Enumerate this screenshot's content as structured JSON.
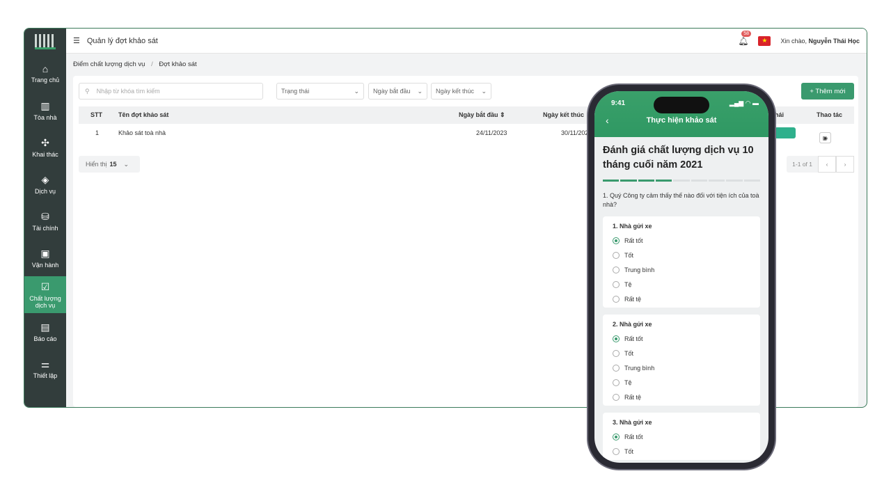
{
  "sidebar": {
    "items": [
      {
        "label": "Trang chủ",
        "icon": "home-icon",
        "glyph": "⌂"
      },
      {
        "label": "Tòa nhà",
        "icon": "building-icon",
        "glyph": "▥"
      },
      {
        "label": "Khai thác",
        "icon": "handshake-icon",
        "glyph": "✣"
      },
      {
        "label": "Dịch vụ",
        "icon": "layers-icon",
        "glyph": "◈"
      },
      {
        "label": "Tài chính",
        "icon": "coins-icon",
        "glyph": "⛁"
      },
      {
        "label": "Vận hành",
        "icon": "briefcase-icon",
        "glyph": "▣"
      },
      {
        "label": "Chất lượng dịch vụ",
        "icon": "calendar-check-icon",
        "glyph": "☑",
        "active": true
      },
      {
        "label": "Báo cáo",
        "icon": "report-icon",
        "glyph": "▤"
      },
      {
        "label": "Thiết lập",
        "icon": "sliders-icon",
        "glyph": "⚌"
      }
    ]
  },
  "header": {
    "title": "Quản lý đợt khảo sát",
    "notifications": "58",
    "greeting": "Xin chào,",
    "user": "Nguyễn Thái Học"
  },
  "breadcrumb": {
    "parent": "Điểm chất lượng dịch vụ",
    "sep": "/",
    "current": "Đợt khảo sát"
  },
  "filters": {
    "search_placeholder": "Nhập từ khóa tìm kiếm",
    "status": "Trạng thái",
    "start": "Ngày bắt đầu",
    "end": "Ngày kết thúc",
    "add": "+ Thêm mới"
  },
  "table": {
    "headers": [
      "STT",
      "Tên đợt khảo sát",
      "Ngày bắt đầu",
      "Ngày kết thúc",
      "hái",
      "Thao tác"
    ],
    "rows": [
      {
        "stt": "1",
        "name": "Khảo sát toà nhà",
        "start": "24/11/2023",
        "end": "30/11/2023"
      }
    ]
  },
  "footer": {
    "show_label": "Hiển thị",
    "page_size": "15",
    "range": "1-1 of 1"
  },
  "phone": {
    "time": "9:41",
    "title": "Thực hiện khảo sát",
    "survey_title": "Đánh giá chất lượng dịch vụ 10 tháng cuối năm 2021",
    "progress": {
      "done": 4,
      "total": 9
    },
    "question": "1. Quý Công ty cảm thấy thế nào đối với tiện ích của toà nhà?",
    "cards": [
      {
        "title": "1. Nhà gửi xe",
        "options": [
          "Rất tốt",
          "Tốt",
          "Trung bình",
          "Tệ",
          "Rất tệ"
        ],
        "selected": 0
      },
      {
        "title": "2. Nhà gửi xe",
        "options": [
          "Rất tốt",
          "Tốt",
          "Trung bình",
          "Tệ",
          "Rất tệ"
        ],
        "selected": 0
      },
      {
        "title": "3. Nhà gửi xe",
        "options": [
          "Rất tốt",
          "Tốt"
        ],
        "selected": 0
      }
    ]
  },
  "colors": {
    "accent": "#3a9a6e",
    "sidebar": "#323d3c"
  }
}
